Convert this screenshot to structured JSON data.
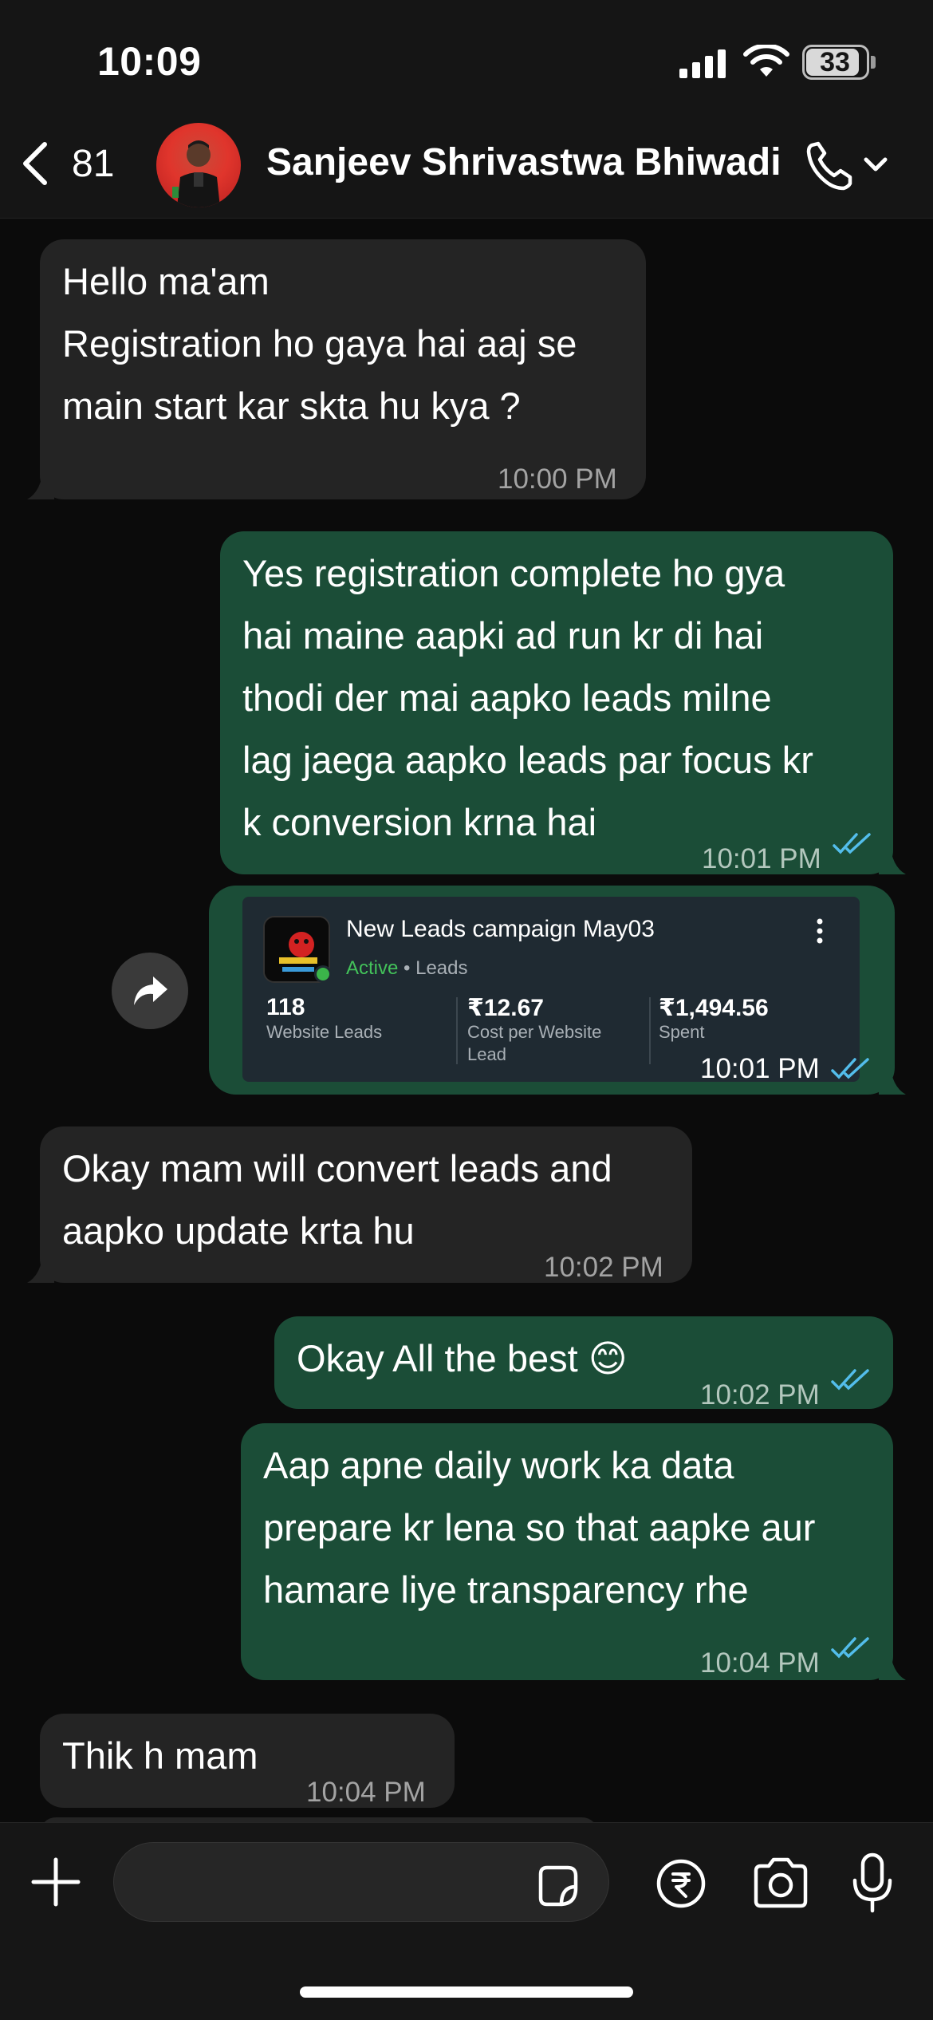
{
  "status_bar": {
    "time": "10:09",
    "battery": "33"
  },
  "header": {
    "back_count": "81",
    "contact_name": "Sanjeev Shrivastwa Bhiwadi"
  },
  "messages": [
    {
      "direction": "incoming",
      "text": "Hello ma'am\nRegistration ho gaya hai aaj se\nmain start kar skta hu kya ?",
      "time": "10:00 PM"
    },
    {
      "direction": "outgoing",
      "text": "Yes registration complete ho gya\nhai maine aapki ad run kr di hai\nthodi der mai aapko leads  milne\nlag jaega aapko leads par focus kr\nk conversion krna hai",
      "time": "10:01 PM",
      "status": "read"
    },
    {
      "direction": "outgoing",
      "type": "ad_card",
      "time": "10:01 PM",
      "status": "read"
    },
    {
      "direction": "incoming",
      "text": "Okay mam will convert leads and\naapko update krta hu",
      "time": "10:02 PM"
    },
    {
      "direction": "outgoing",
      "text": "Okay All the best 😊",
      "time": "10:02 PM",
      "status": "read"
    },
    {
      "direction": "outgoing",
      "text": "Aap apne daily work ka data\nprepare kr lena so that aapke aur\nhamare liye transparency rhe",
      "time": "10:04 PM",
      "status": "read"
    },
    {
      "direction": "incoming",
      "text": "Thik h mam",
      "time": "10:04 PM"
    }
  ],
  "ad_card": {
    "title": "New Leads campaign May03",
    "status": "Active",
    "objective": "• Leads",
    "stats": [
      {
        "value": "118",
        "label": "Website Leads"
      },
      {
        "value": "₹12.67",
        "label": "Cost per Website\nLead"
      },
      {
        "value": "₹1,494.56",
        "label": "Spent"
      }
    ]
  },
  "input": {
    "placeholder": ""
  },
  "colors": {
    "incoming_bubble": "#242424",
    "outgoing_bubble": "#1b4d37",
    "read_ticks": "#53bdeb",
    "active_green": "#43c25a"
  },
  "icons": [
    "back-chevron-icon",
    "phone-icon",
    "chevron-down-icon",
    "forward-icon",
    "more-vertical-icon",
    "plus-icon",
    "sticker-icon",
    "rupee-icon",
    "camera-icon",
    "mic-icon"
  ]
}
